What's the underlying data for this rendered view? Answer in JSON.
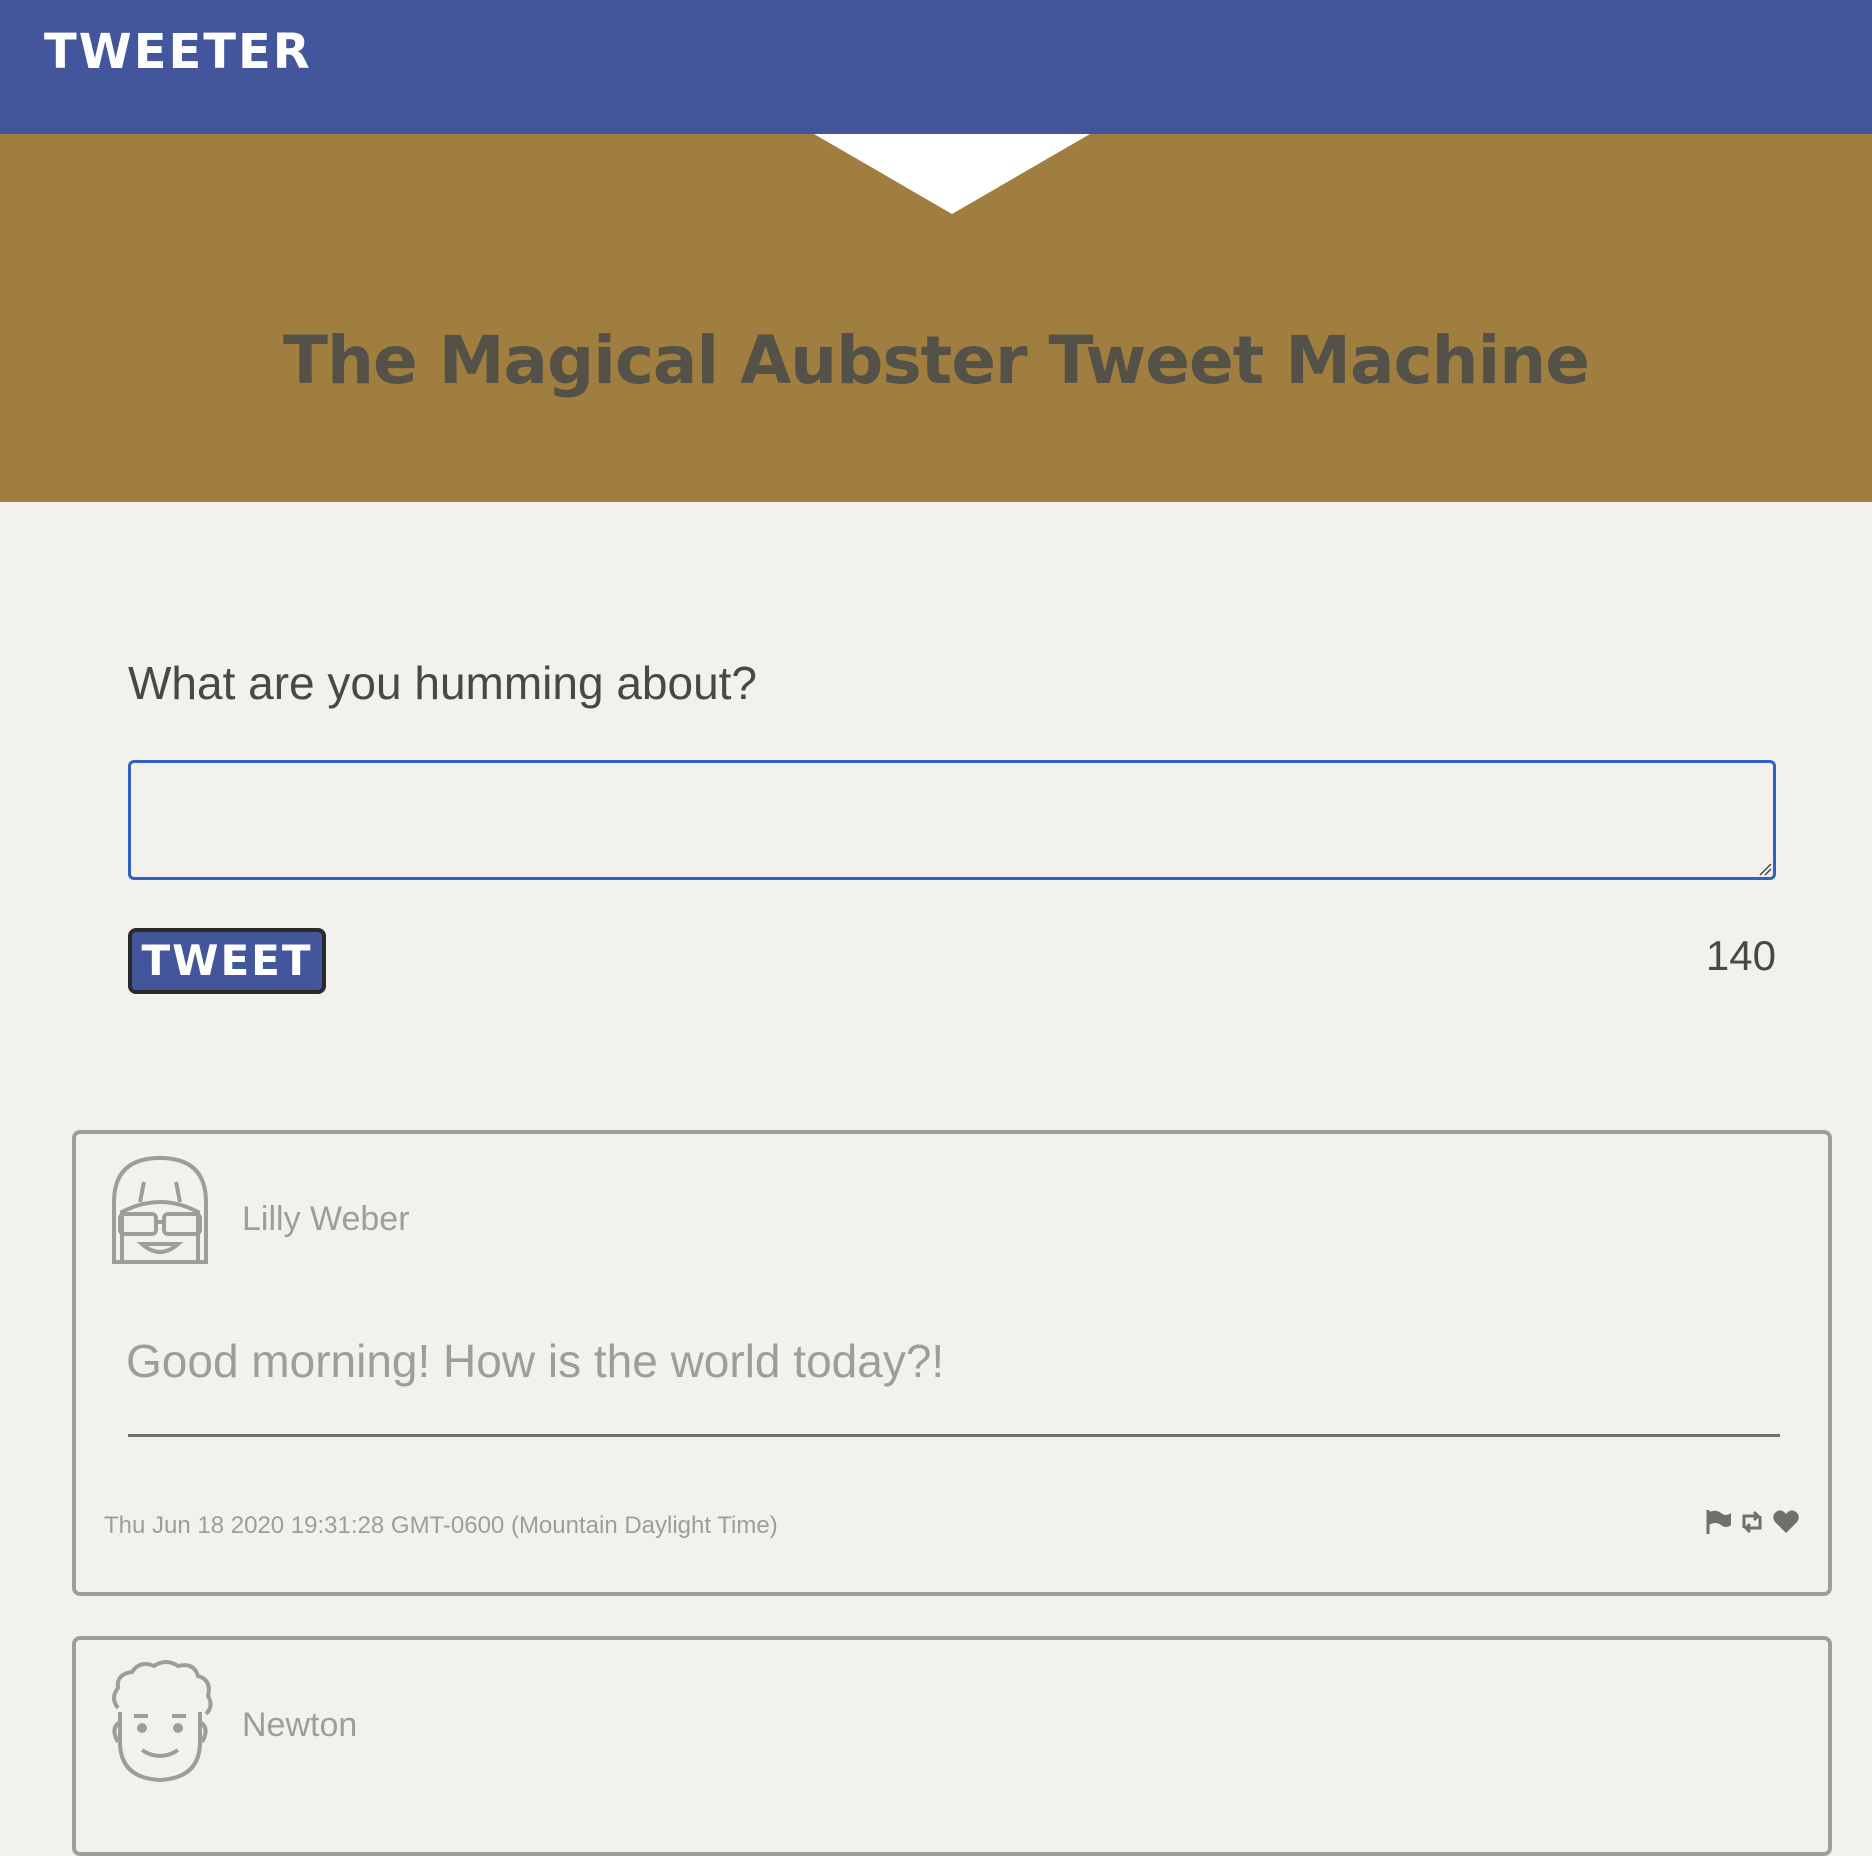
{
  "nav": {
    "brand": "TWEETER"
  },
  "hero": {
    "title": "The Magical Aubster Tweet Machine"
  },
  "compose": {
    "label": "What are you humming about?",
    "value": "",
    "placeholder": "",
    "button_label": "TWEET",
    "counter": "140"
  },
  "tweets": [
    {
      "author": "Lilly Weber",
      "avatar_icon": "avatar-glasses-icon",
      "text": "Good morning! How is the world today?!",
      "date": "Thu Jun 18 2020 19:31:28 GMT-0600 (Mountain Daylight Time)",
      "actions": [
        "flag-icon",
        "retweet-icon",
        "heart-icon"
      ]
    },
    {
      "author": "Newton",
      "avatar_icon": "avatar-curly-icon"
    }
  ],
  "colors": {
    "nav_bg": "#44569b",
    "hero_bg": "#a07e3f",
    "page_bg": "#f2f1ed",
    "muted_text": "#9e9d99",
    "dark_text": "#545149",
    "input_border": "#2f63c0"
  }
}
